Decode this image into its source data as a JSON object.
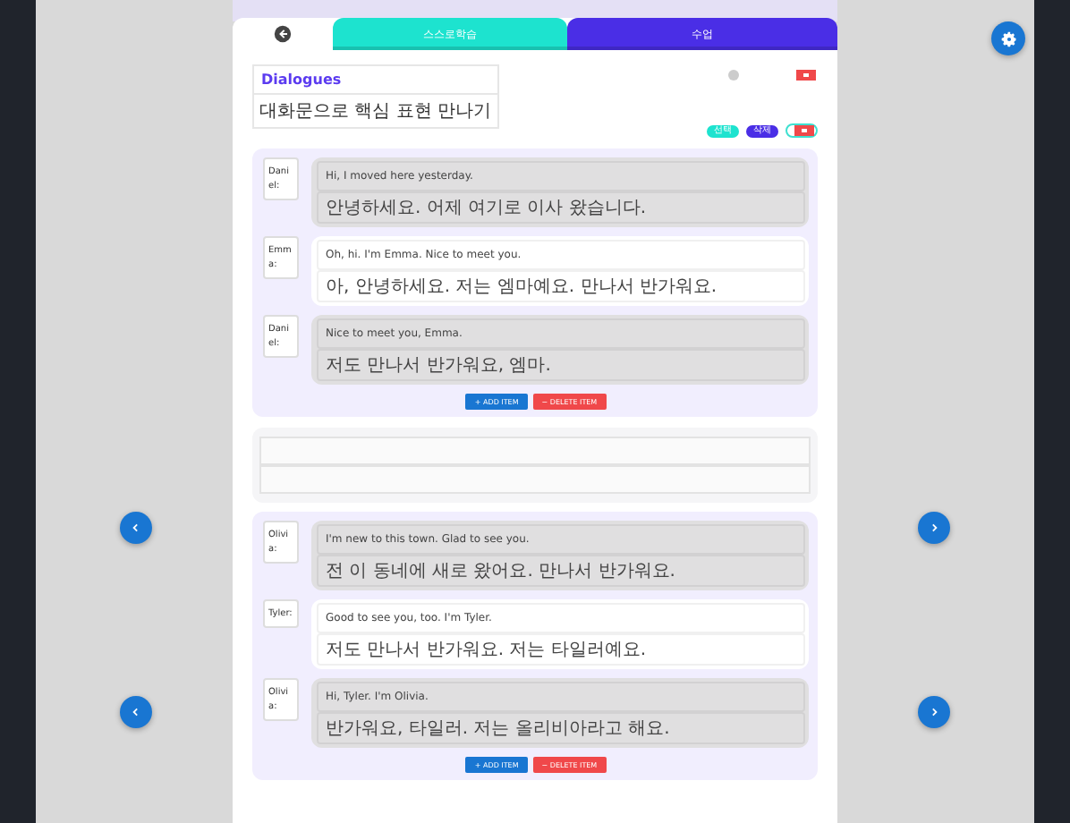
{
  "tabs": [
    {
      "kind": "back",
      "selected": true,
      "color": "#ffffff"
    },
    {
      "kind": "text",
      "label": "스스로학습",
      "selected": false,
      "color": "#1de3cf"
    },
    {
      "kind": "text",
      "label": "수업",
      "selected": false,
      "color": "#4a2ee6"
    }
  ],
  "header": {
    "title": "Dialogues",
    "subtitle": "대화문으로 핵심 표현 만나기"
  },
  "pills": [
    {
      "label": "선택",
      "color": "#1de3cf"
    },
    {
      "label": "삭제",
      "color": "#4a2ee6"
    }
  ],
  "dialogues": [
    {
      "lines": [
        {
          "speaker": "Daniel:",
          "kind": "other",
          "english": "Hi, I moved here yesterday.",
          "korean": "안녕하세요. 어제 여기로 이사 왔습니다."
        },
        {
          "speaker": "Emma:",
          "kind": "self",
          "english": "Oh, hi. I'm Emma. Nice to meet you.",
          "korean": "아, 안녕하세요. 저는 엠마예요. 만나서 반가워요."
        },
        {
          "speaker": "Daniel:",
          "kind": "other",
          "english": "Nice to meet you, Emma.",
          "korean": "저도 만나서 반가워요, 엠마."
        }
      ],
      "buttons": [
        {
          "kind": "add",
          "label": "+  ADD ITEM"
        },
        {
          "kind": "delete",
          "label": "−  DELETE ITEM"
        }
      ]
    },
    {
      "lines": [
        {
          "speaker": "Olivia:",
          "kind": "other",
          "english": "I'm new to this town. Glad to see you.",
          "korean": "전 이 동네에 새로 왔어요. 만나서 반가워요."
        },
        {
          "speaker": "Tyler:",
          "kind": "self",
          "english": "Good to see you, too. I'm Tyler.",
          "korean": "저도 만나서 반가워요. 저는 타일러예요."
        },
        {
          "speaker": "Olivia:",
          "kind": "other",
          "english": "Hi, Tyler. I'm Olivia.",
          "korean": "반가워요, 타일러. 저는 올리비아라고 해요."
        }
      ],
      "buttons": [
        {
          "kind": "add",
          "label": "+  ADD ITEM"
        },
        {
          "kind": "delete",
          "label": "−  DELETE ITEM"
        }
      ]
    }
  ]
}
